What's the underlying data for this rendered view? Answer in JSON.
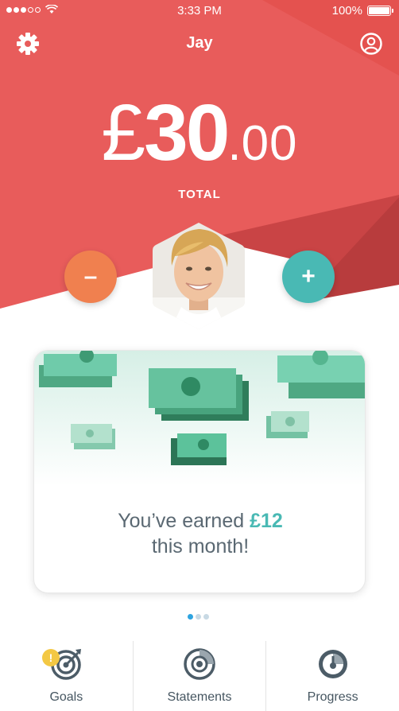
{
  "status_bar": {
    "time": "3:33 PM",
    "battery": "100%",
    "wifi_icon": "wifi-icon"
  },
  "header": {
    "title": "Jay",
    "settings_icon": "gear-icon",
    "profile_icon": "user-circle-icon"
  },
  "balance": {
    "currency": "£",
    "whole": "30",
    "separator": ".",
    "pence": "00",
    "label": "TOTAL"
  },
  "actions": {
    "decrease_label": "–",
    "increase_label": "+"
  },
  "card": {
    "line1_prefix": "You’ve earned ",
    "line1_amount": "£12",
    "line2": "this month!"
  },
  "pager": {
    "pages": 3,
    "active": 0
  },
  "tabs": [
    {
      "label": "Goals",
      "icon": "target-icon",
      "badge": "!"
    },
    {
      "label": "Statements",
      "icon": "statement-disc-icon"
    },
    {
      "label": "Progress",
      "icon": "gauge-icon"
    }
  ],
  "colors": {
    "hero_red": "#e85c5b",
    "hero_dark_red": "#c94445",
    "minus_orange": "#f0804f",
    "plus_teal": "#49b9b4",
    "money_green": "#5cc29b",
    "text_gray": "#5a6872",
    "badge_yellow": "#f3c844"
  }
}
